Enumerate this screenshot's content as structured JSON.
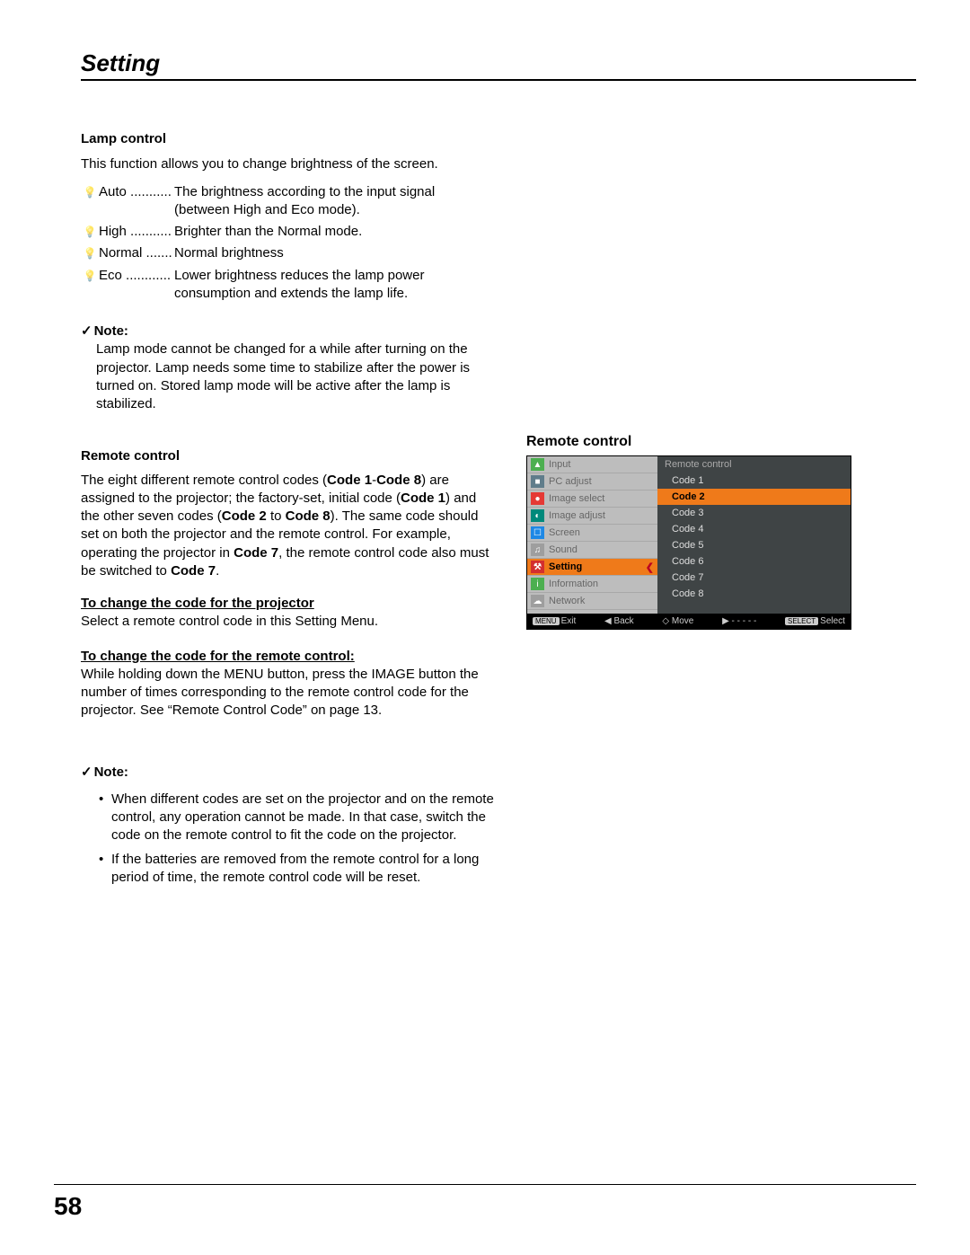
{
  "page_title": "Setting",
  "page_number": "58",
  "lamp": {
    "title": "Lamp control",
    "intro": "This function allows you to change brightness of the screen.",
    "items": [
      {
        "icon": "💡",
        "label": "Auto",
        "dots": "...........",
        "desc": "The brightness according to the input signal (between High and Eco mode)."
      },
      {
        "icon": "💡",
        "label": "High",
        "dots": "...........",
        "desc": "Brighter than the Normal mode."
      },
      {
        "icon": "💡",
        "label": "Normal",
        "dots": ".......",
        "desc": "Normal brightness"
      },
      {
        "icon": "💡",
        "label": "Eco",
        "dots": "............",
        "desc": "Lower brightness reduces the lamp power consumption and extends the lamp life."
      }
    ],
    "note_label": "Note:",
    "note_body": "Lamp mode cannot be changed for a while after turning on the projector. Lamp needs some time to stabilize after the power is turned on. Stored lamp mode will be active after the lamp is stabilized."
  },
  "remote": {
    "title": "Remote control",
    "para": {
      "pre": "The eight different remote control codes (",
      "b1": "Code 1",
      "mid1": "-",
      "b2": "Code 8",
      "mid2": ") are assigned to the projector; the factory-set, initial code (",
      "b3": "Code 1",
      "mid3": ") and the other seven codes (",
      "b4": "Code 2",
      "mid4": " to ",
      "b5": "Code 8",
      "mid5": "). The same code should set on both the projector and the remote control. For example, operating the projector in ",
      "b6": "Code 7",
      "mid6": ", the remote control code also must be switched to ",
      "b7": "Code 7",
      "end": "."
    },
    "proj_title": "To change the code for the projector",
    "proj_body": "Select a remote control code in this Setting Menu.",
    "rc_title": "To change the code for the remote control:",
    "rc_body": "While holding down the MENU button, press the IMAGE button the number of times corresponding to the remote control code for the projector. See “Remote Control Code” on page 13.",
    "note_label": "Note:",
    "notes": [
      "When different codes are set on the projector and on the remote control, any operation cannot be made. In that case, switch the code on the remote control to fit the code on the projector.",
      "If the batteries are removed from the remote control for a long period of time, the remote control code will be reset."
    ]
  },
  "osd": {
    "caption": "Remote control",
    "menu": [
      {
        "name": "Input",
        "icon_bg": "#4caf50",
        "glyph": "▲"
      },
      {
        "name": "PC adjust",
        "icon_bg": "#607d8b",
        "glyph": "■"
      },
      {
        "name": "Image select",
        "icon_bg": "#e53935",
        "glyph": "●"
      },
      {
        "name": "Image adjust",
        "icon_bg": "#00897b",
        "glyph": "◐"
      },
      {
        "name": "Screen",
        "icon_bg": "#1e88e5",
        "glyph": "☐"
      },
      {
        "name": "Sound",
        "icon_bg": "#9e9e9e",
        "glyph": "♫"
      },
      {
        "name": "Setting",
        "icon_bg": "#d32f2f",
        "glyph": "⚒",
        "active": true
      },
      {
        "name": "Information",
        "icon_bg": "#4caf50",
        "glyph": "i"
      },
      {
        "name": "Network",
        "icon_bg": "#9e9e9e",
        "glyph": "☁"
      }
    ],
    "right_title": "Remote control",
    "codes": [
      "Code 1",
      "Code 2",
      "Code 3",
      "Code 4",
      "Code 5",
      "Code 6",
      "Code 7",
      "Code 8"
    ],
    "selected_code_index": 1,
    "footer": {
      "exit_key": "MENU",
      "exit": "Exit",
      "back": "◀ Back",
      "move": "◇ Move",
      "dashes": "▶ - - - - -",
      "select_key": "SELECT",
      "select": "Select"
    }
  }
}
